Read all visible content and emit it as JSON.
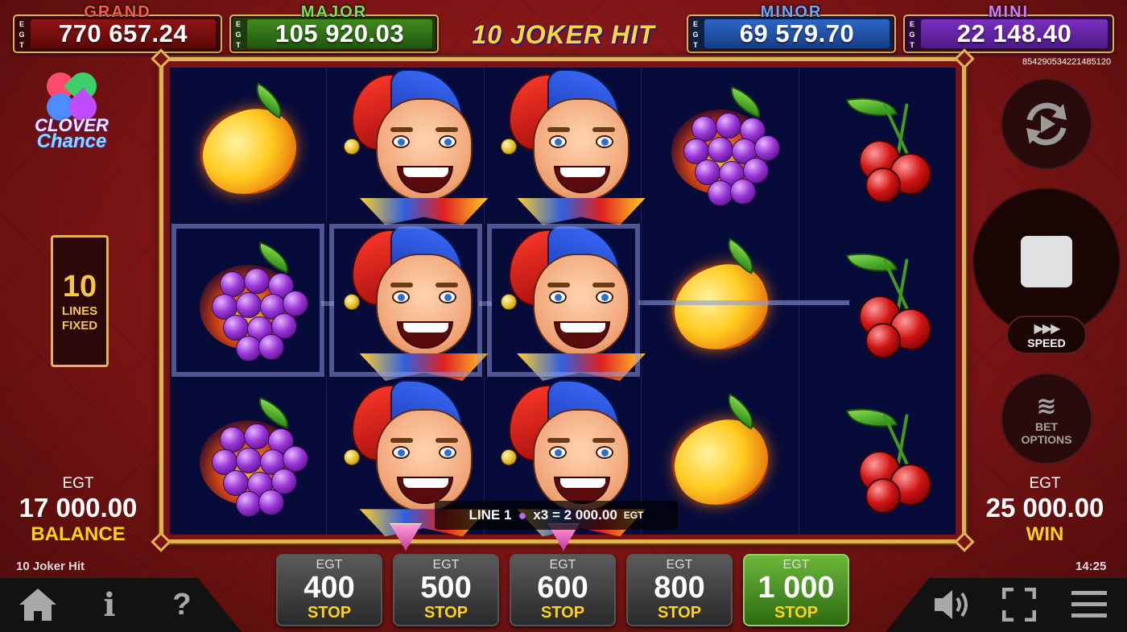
{
  "jackpots": {
    "grand": {
      "label": "GRAND",
      "egt": [
        "E",
        "G",
        "T"
      ],
      "value": "770 657.24"
    },
    "major": {
      "label": "MAJOR",
      "egt": [
        "E",
        "G",
        "T"
      ],
      "value": "105 920.03"
    },
    "minor": {
      "label": "MINOR",
      "egt": [
        "E",
        "G",
        "T"
      ],
      "value": "69 579.70"
    },
    "mini": {
      "label": "MINI",
      "egt": [
        "E",
        "G",
        "T"
      ],
      "value": "22 148.40"
    }
  },
  "game_logo": "10 JOKER HIT",
  "ticket_id": "854290534221485120",
  "side_logo": {
    "line1": "CLOVER",
    "line2": "Chance"
  },
  "lines_box": {
    "count": "10",
    "line1": "LINES",
    "line2": "FIXED"
  },
  "balance": {
    "currency": "EGT",
    "amount": "17 000.00",
    "caption": "BALANCE"
  },
  "win": {
    "currency": "EGT",
    "amount": "25 000.00",
    "caption": "WIN"
  },
  "game_name": "10 Joker Hit",
  "clock": "14:25",
  "reels": [
    [
      "lemon",
      "grapes",
      "grapes"
    ],
    [
      "joker",
      "joker",
      "joker"
    ],
    [
      "joker",
      "joker",
      "joker"
    ],
    [
      "grapes",
      "lemon",
      "lemon"
    ],
    [
      "cherries",
      "cherries",
      "cherries"
    ]
  ],
  "win_line": {
    "prefix": "LINE 1",
    "symbol": "grapes-icon",
    "text": "x3 = 2 000.00",
    "unit": "EGT"
  },
  "controls": {
    "autoplay_icon": "autoplay-icon",
    "spin_icon": "stop-icon",
    "speed_label": "SPEED",
    "speed_icon": "▶▶▶",
    "bet_options_line1": "BET",
    "bet_options_line2": "OPTIONS"
  },
  "bet_buttons": [
    {
      "currency": "EGT",
      "amount": "400",
      "stop": "STOP",
      "active": false
    },
    {
      "currency": "EGT",
      "amount": "500",
      "stop": "STOP",
      "active": false
    },
    {
      "currency": "EGT",
      "amount": "600",
      "stop": "STOP",
      "active": false
    },
    {
      "currency": "EGT",
      "amount": "800",
      "stop": "STOP",
      "active": false
    },
    {
      "currency": "EGT",
      "amount": "1 000",
      "stop": "STOP",
      "active": true
    }
  ],
  "bottom_icons": {
    "home": "home-icon",
    "info": "i",
    "help": "?",
    "sound": "sound-icon",
    "fullscreen": "fullscreen-icon",
    "menu": "menu-icon"
  },
  "colors": {
    "frame_gold": "#e0b455",
    "bg_red": "#7a1414",
    "stop_yellow": "#ffd21a",
    "active_green": "#4e9a26"
  }
}
